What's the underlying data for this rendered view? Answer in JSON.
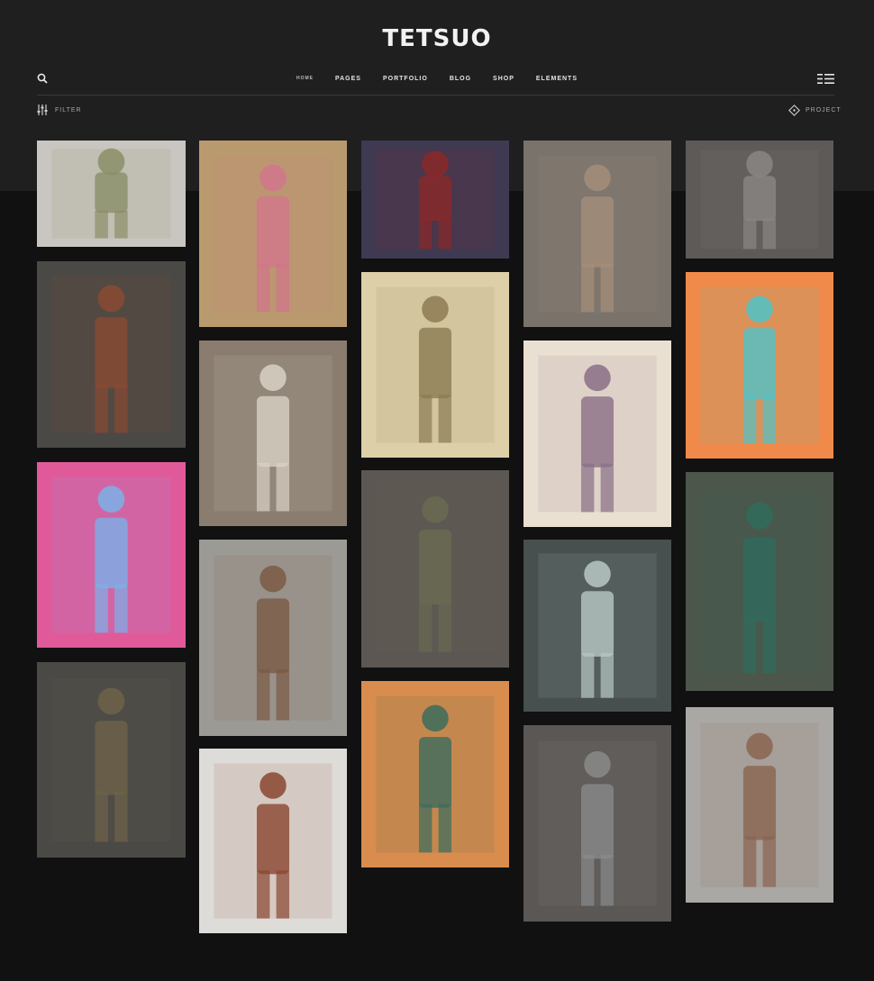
{
  "header": {
    "logo": "TETSUO",
    "nav": [
      {
        "label": "HOME"
      },
      {
        "label": "PAGES"
      },
      {
        "label": "PORTFOLIO"
      },
      {
        "label": "BLOG"
      },
      {
        "label": "SHOP"
      },
      {
        "label": "ELEMENTS"
      }
    ],
    "icons": {
      "search": "search-icon",
      "menu": "menu-icon"
    }
  },
  "toolbar": {
    "filter_label": "FILTER",
    "project_label": "PROJECT",
    "icons": {
      "filter": "sliders-icon",
      "project": "diamond-icon"
    }
  },
  "gallery": {
    "items": [
      {
        "name": "robot-sketch-sheet",
        "bg": "#c9c5c0",
        "fg": "#8a8f66"
      },
      {
        "name": "pink-warrior-illustration",
        "bg": "#b99a6e",
        "fg": "#d2758c"
      },
      {
        "name": "motorcycle-scene",
        "bg": "#3f3a52",
        "fg": "#8c2828"
      },
      {
        "name": "pilgrim-sketch",
        "bg": "#7a736c",
        "fg": "#a58e7a"
      },
      {
        "name": "hangar-line-drawing",
        "bg": "#5d5a58",
        "fg": "#8a8684"
      },
      {
        "name": "armored-soldier",
        "bg": "#4b4946",
        "fg": "#8a4a32"
      },
      {
        "name": "masked-figure-sketch",
        "bg": "#8a7d70",
        "fg": "#d8d2c4"
      },
      {
        "name": "faces-line-sketch",
        "bg": "#ddd0a8",
        "fg": "#8c7a54"
      },
      {
        "name": "swordswoman-sketch",
        "bg": "#eae0d2",
        "fg": "#8a6f86"
      },
      {
        "name": "neon-faces",
        "bg": "#f08a4a",
        "fg": "#4fc3c8"
      },
      {
        "name": "pink-neon-pilot",
        "bg": "#e05a9a",
        "fg": "#7ab0e8"
      },
      {
        "name": "scout-on-grey",
        "bg": "#9c9a94",
        "fg": "#7a5a44"
      },
      {
        "name": "spiked-helmet-figure",
        "bg": "#5c5753",
        "fg": "#6a6a52"
      },
      {
        "name": "bad-poster",
        "bg": "#47504e",
        "fg": "#b8c8c4"
      },
      {
        "name": "centaur-rider",
        "bg": "#4d564a",
        "fg": "#2f6c5c"
      },
      {
        "name": "heavy-mech-soldier",
        "bg": "#4a4946",
        "fg": "#6e6248"
      },
      {
        "name": "soldier-with-backpack",
        "bg": "#dedcd8",
        "fg": "#8a4630"
      },
      {
        "name": "red-haired-woman",
        "bg": "#d88c4e",
        "fg": "#3c6c5c"
      },
      {
        "name": "hooded-archer",
        "bg": "#5a5754",
        "fg": "#8a8a8a"
      },
      {
        "name": "gunner-figure",
        "bg": "#aaa8a4",
        "fg": "#8a6450"
      }
    ]
  }
}
